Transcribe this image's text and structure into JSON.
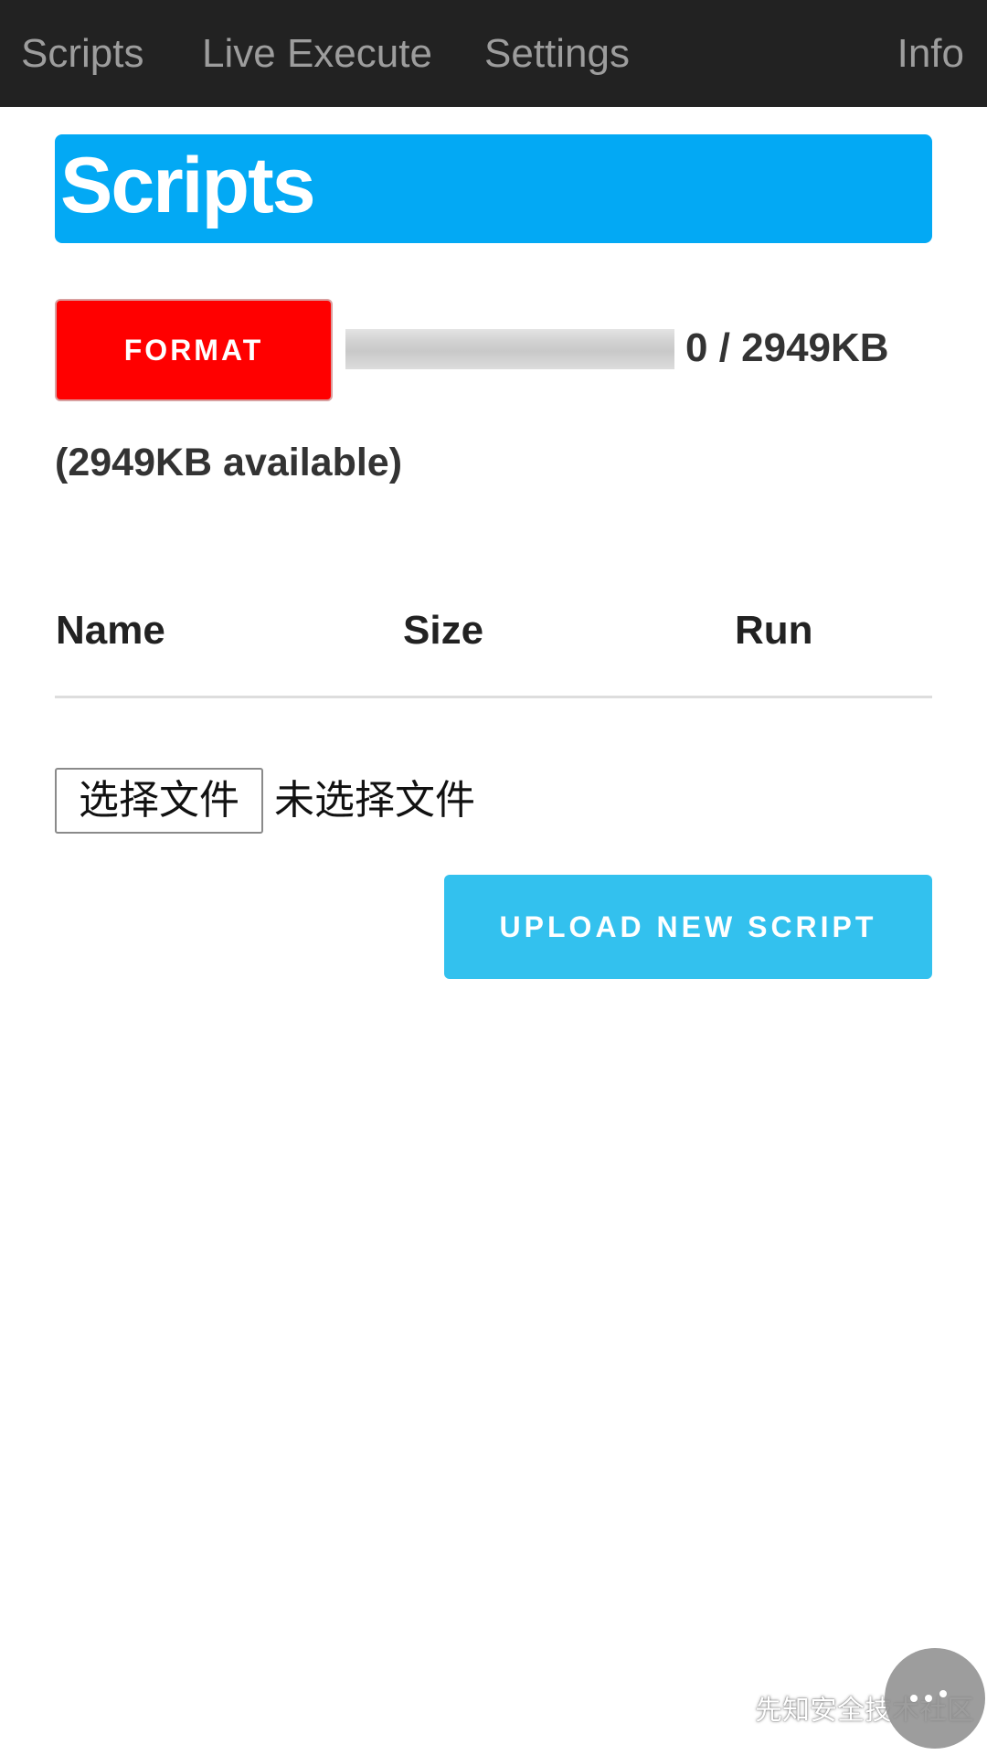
{
  "nav": {
    "items": [
      {
        "label": "Scripts"
      },
      {
        "label": "Live Execute"
      },
      {
        "label": "Settings"
      },
      {
        "label": "Info"
      }
    ]
  },
  "page": {
    "title": "Scripts"
  },
  "storage": {
    "format_label": "FORMAT",
    "usage_text": "0 / 2949KB",
    "used_fraction": 0,
    "available_text": "(2949KB available)"
  },
  "table": {
    "columns": [
      "Name",
      "Size",
      "Run"
    ],
    "rows": []
  },
  "file_input": {
    "button_label": "选择文件",
    "status": "未选择文件"
  },
  "upload": {
    "label": "UPLOAD NEW SCRIPT"
  },
  "watermark": {
    "text": "先知安全技术社区",
    "icon": "wechat-icon"
  },
  "floating_button": {
    "icon": "more-dots-icon"
  },
  "colors": {
    "nav_bg": "#222222",
    "nav_text": "#9d9d9d",
    "accent": "#03a9f4",
    "danger": "#ff0000",
    "upload": "#33c1ee"
  }
}
